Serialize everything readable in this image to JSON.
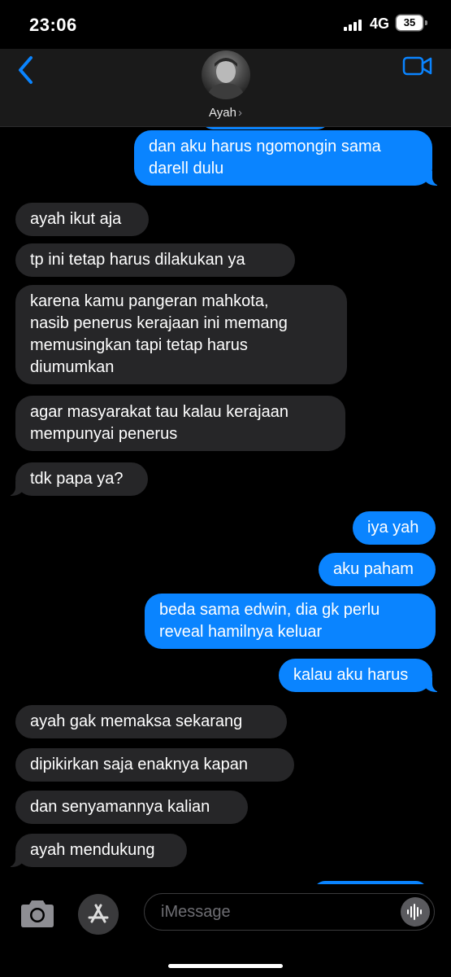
{
  "status_bar": {
    "time": "23:06",
    "network": "4G",
    "battery": "35"
  },
  "header": {
    "contact_name": "Ayah",
    "chevron": "›"
  },
  "messages": [
    {
      "from": "out",
      "lines": [
        "dan aku harus ngomongin sama",
        "darell dulu"
      ]
    },
    {
      "from": "in",
      "lines": [
        "ayah ikut aja"
      ]
    },
    {
      "from": "in",
      "lines": [
        "tp ini tetap harus dilakukan ya"
      ]
    },
    {
      "from": "in",
      "lines": [
        "karena kamu pangeran mahkota,",
        "nasib penerus kerajaan ini memang",
        "memusingkan tapi tetap harus",
        "diumumkan"
      ]
    },
    {
      "from": "in",
      "lines": [
        "agar masyarakat tau kalau kerajaan",
        "mempunyai penerus"
      ]
    },
    {
      "from": "in",
      "lines": [
        "tdk papa ya?"
      ]
    },
    {
      "from": "out",
      "lines": [
        "iya yah"
      ]
    },
    {
      "from": "out",
      "lines": [
        "aku paham"
      ]
    },
    {
      "from": "out",
      "lines": [
        "beda sama edwin, dia gk perlu",
        "reveal hamilnya keluar"
      ]
    },
    {
      "from": "out",
      "lines": [
        "kalau aku harus"
      ]
    },
    {
      "from": "in",
      "lines": [
        "ayah gak memaksa sekarang"
      ]
    },
    {
      "from": "in",
      "lines": [
        "dipikirkan saja enaknya kapan"
      ]
    },
    {
      "from": "in",
      "lines": [
        "dan senyamannya kalian"
      ]
    },
    {
      "from": "in",
      "lines": [
        "ayah mendukung"
      ]
    }
  ],
  "input": {
    "placeholder": "iMessage"
  },
  "icons": {
    "back": "chevron-left-icon",
    "video": "video-camera-icon",
    "camera": "camera-icon",
    "app_store": "app-store-icon",
    "audio": "waveform-icon"
  },
  "colors": {
    "outgoing": "#0a84ff",
    "incoming": "#262628",
    "accent": "#0a84ff"
  }
}
